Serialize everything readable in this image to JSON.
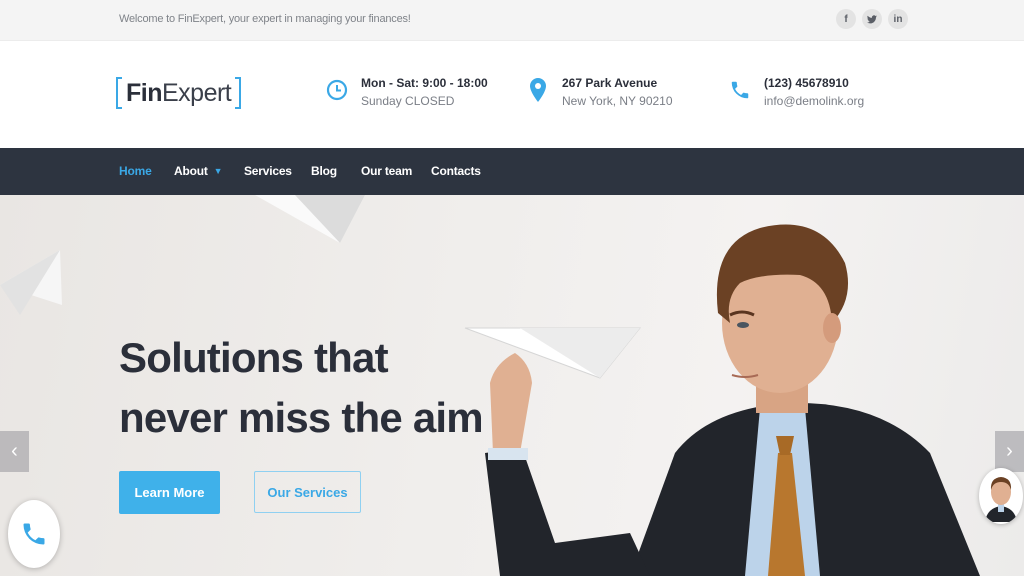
{
  "topbar": {
    "welcome": "Welcome to FinExpert, your expert in managing your finances!",
    "social": [
      {
        "icon": "facebook-icon",
        "glyph": "f"
      },
      {
        "icon": "twitter-icon",
        "glyph": "ᵛ"
      },
      {
        "icon": "linkedin-icon",
        "glyph": "in"
      }
    ]
  },
  "header": {
    "logo_bold": "Fin",
    "logo_light": "Expert",
    "hours": {
      "line1": "Mon - Sat: 9:00 - 18:00",
      "line2": "Sunday CLOSED",
      "icon": "clock-icon"
    },
    "address": {
      "line1": "267 Park Avenue",
      "line2": "New York, NY 90210",
      "icon": "location-pin-icon"
    },
    "contact": {
      "line1": "(123) 45678910",
      "line2": "info@demolink.org",
      "icon": "phone-icon"
    }
  },
  "nav": {
    "items": [
      {
        "label": "Home",
        "active": true
      },
      {
        "label": "About",
        "dropdown": true
      },
      {
        "label": "Services"
      },
      {
        "label": "Blog"
      },
      {
        "label": "Our team"
      },
      {
        "label": "Contacts"
      }
    ]
  },
  "hero": {
    "title_line1": "Solutions that",
    "title_line2": "never miss the aim",
    "primary_button": "Learn More",
    "secondary_button": "Our Services"
  },
  "colors": {
    "accent": "#3aa8e6",
    "nav_bg": "#2d3440",
    "text_dark": "#2b2f3a"
  }
}
